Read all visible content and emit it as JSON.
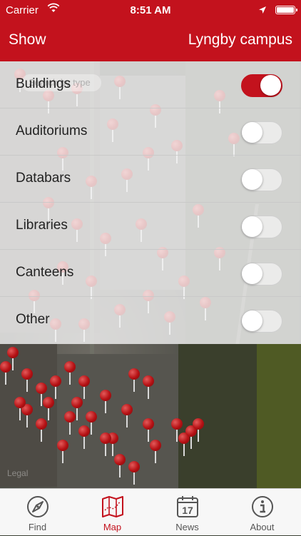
{
  "status_bar": {
    "carrier": "Carrier",
    "time": "8:51 AM"
  },
  "nav": {
    "left_button": "Show",
    "title": "Lyngby campus"
  },
  "map": {
    "legal_label": "Legal",
    "search_placeholder": "Search by type"
  },
  "filters": [
    {
      "label": "Buildings",
      "enabled": true
    },
    {
      "label": "Auditoriums",
      "enabled": false
    },
    {
      "label": "Databars",
      "enabled": false
    },
    {
      "label": "Libraries",
      "enabled": false
    },
    {
      "label": "Canteens",
      "enabled": false
    },
    {
      "label": "Other",
      "enabled": false
    }
  ],
  "tabs": [
    {
      "label": "Find",
      "icon": "compass-icon",
      "active": false
    },
    {
      "label": "Map",
      "icon": "map-icon",
      "active": true
    },
    {
      "label": "News",
      "icon": "calendar-icon",
      "active": false,
      "calendar_day": "17"
    },
    {
      "label": "About",
      "icon": "info-icon",
      "active": false
    }
  ],
  "colors": {
    "accent": "#c3121d",
    "tab_inactive": "#555555",
    "toggle_off": "#e6e6e6"
  }
}
